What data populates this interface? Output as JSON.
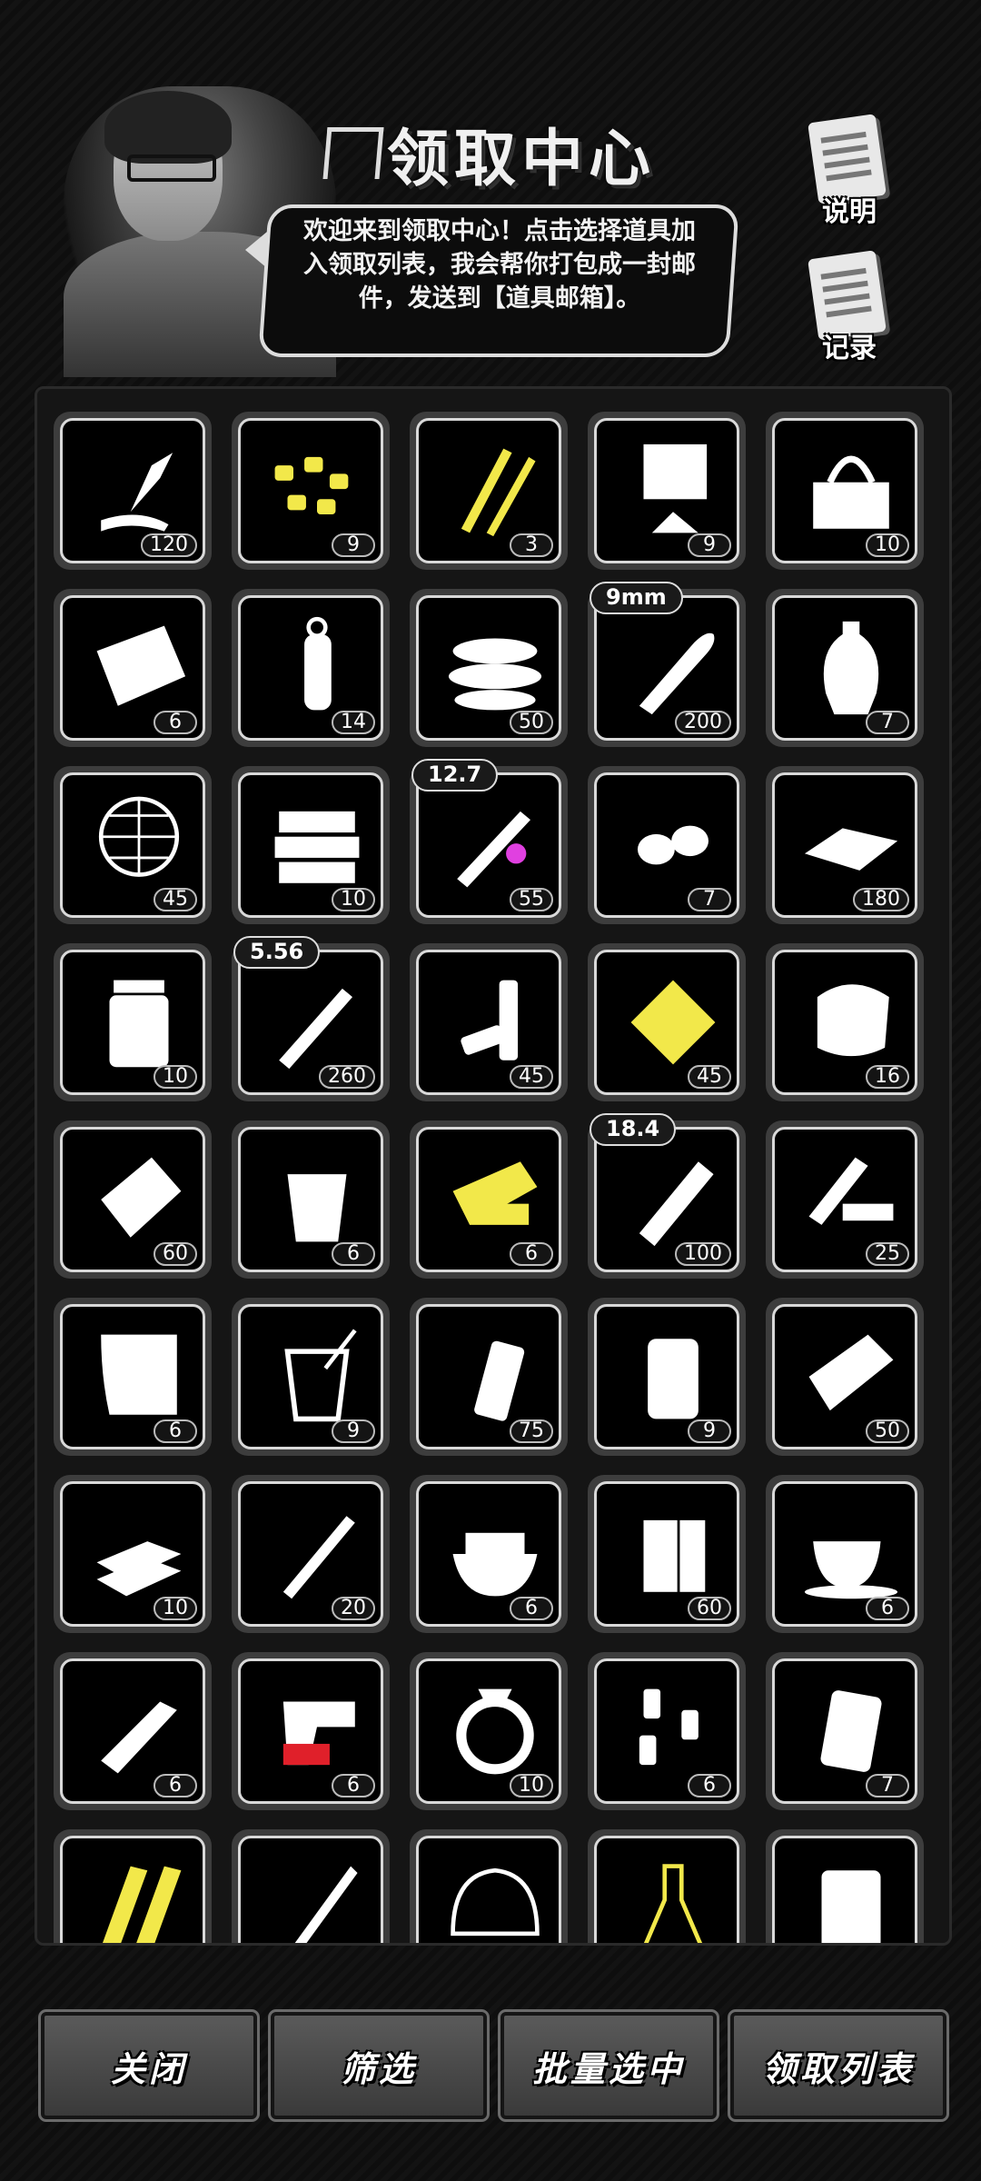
{
  "header": {
    "title": "领取中心",
    "bubble_text": "欢迎来到领取中心！点击选择道具加入领取列表，我会帮你打包成一封邮件，发送到【道具邮箱】。",
    "help_label": "说明",
    "records_label": "记录"
  },
  "items": [
    {
      "icon": "glue-tube-icon",
      "count": "120",
      "tag": "",
      "accent": "#ffffff"
    },
    {
      "icon": "corn-kernels-icon",
      "count": "9",
      "tag": "",
      "accent": "#f2e84a"
    },
    {
      "icon": "fuse-sticks-icon",
      "count": "3",
      "tag": "",
      "accent": "#f2e84a"
    },
    {
      "icon": "powder-bag-icon",
      "count": "9",
      "tag": "",
      "accent": "#ffffff"
    },
    {
      "icon": "toolbox-icon",
      "count": "10",
      "tag": "",
      "accent": "#ffffff"
    },
    {
      "icon": "cloth-rag-icon",
      "count": "6",
      "tag": "",
      "accent": "#ffffff"
    },
    {
      "icon": "grenade-icon",
      "count": "14",
      "tag": "",
      "accent": "#ffffff"
    },
    {
      "icon": "tape-roll-icon",
      "count": "50",
      "tag": "",
      "accent": "#ffffff"
    },
    {
      "icon": "bullet-9mm-icon",
      "count": "200",
      "tag": "9mm",
      "accent": "#ffffff"
    },
    {
      "icon": "vase-icon",
      "count": "7",
      "tag": "",
      "accent": "#ffffff"
    },
    {
      "icon": "net-globe-icon",
      "count": "45",
      "tag": "",
      "accent": "#ffffff"
    },
    {
      "icon": "stacked-cloth-icon",
      "count": "10",
      "tag": "",
      "accent": "#ffffff"
    },
    {
      "icon": "rifle-round-12-7-icon",
      "count": "55",
      "tag": "12.7",
      "accent": "#e040e0"
    },
    {
      "icon": "nuts-icon",
      "count": "7",
      "tag": "",
      "accent": "#ffffff"
    },
    {
      "icon": "cash-bundle-icon",
      "count": "180",
      "tag": "",
      "accent": "#ffffff"
    },
    {
      "icon": "medicine-bottle-icon",
      "count": "10",
      "tag": "",
      "accent": "#ffffff"
    },
    {
      "icon": "rifle-round-5-56-icon",
      "count": "260",
      "tag": "5.56",
      "accent": "#ffffff"
    },
    {
      "icon": "batteries-icon",
      "count": "45",
      "tag": "",
      "accent": "#ffffff"
    },
    {
      "icon": "gear-part-icon",
      "count": "45",
      "tag": "",
      "accent": "#f2e84a"
    },
    {
      "icon": "cloth-roll-icon",
      "count": "16",
      "tag": "",
      "accent": "#ffffff"
    },
    {
      "icon": "metal-plate-icon",
      "count": "60",
      "tag": "",
      "accent": "#ffffff"
    },
    {
      "icon": "juice-glass-icon",
      "count": "6",
      "tag": "",
      "accent": "#ffffff"
    },
    {
      "icon": "weapon-parts-icon",
      "count": "6",
      "tag": "",
      "accent": "#f2e84a"
    },
    {
      "icon": "shotgun-shell-18-4-icon",
      "count": "100",
      "tag": "18.4",
      "accent": "#ffffff"
    },
    {
      "icon": "wood-planks-icon",
      "count": "25",
      "tag": "",
      "accent": "#ffffff"
    },
    {
      "icon": "blueprint-scroll-icon",
      "count": "6",
      "tag": "",
      "accent": "#ffffff"
    },
    {
      "icon": "drink-straw-icon",
      "count": "9",
      "tag": "",
      "accent": "#ffffff"
    },
    {
      "icon": "smoke-grenade-icon",
      "count": "75",
      "tag": "",
      "accent": "#ffffff"
    },
    {
      "icon": "pickle-jar-icon",
      "count": "9",
      "tag": "",
      "accent": "#ffffff"
    },
    {
      "icon": "gun-parts-icon",
      "count": "50",
      "tag": "",
      "accent": "#ffffff"
    },
    {
      "icon": "gold-bars-icon",
      "count": "10",
      "tag": "",
      "accent": "#ffffff"
    },
    {
      "icon": "rocket-icon",
      "count": "20",
      "tag": "",
      "accent": "#ffffff"
    },
    {
      "icon": "sugar-bowl-icon",
      "count": "6",
      "tag": "",
      "accent": "#ffffff"
    },
    {
      "icon": "battery-pack-icon",
      "count": "60",
      "tag": "",
      "accent": "#ffffff"
    },
    {
      "icon": "coffee-cup-icon",
      "count": "6",
      "tag": "",
      "accent": "#ffffff"
    },
    {
      "icon": "ointment-tube-icon",
      "count": "6",
      "tag": "",
      "accent": "#ffffff"
    },
    {
      "icon": "flare-gun-icon",
      "count": "6",
      "tag": "",
      "accent": "#e0202a"
    },
    {
      "icon": "ring-icon",
      "count": "10",
      "tag": "",
      "accent": "#ffffff"
    },
    {
      "icon": "pill-bottles-icon",
      "count": "6",
      "tag": "",
      "accent": "#ffffff"
    },
    {
      "icon": "fuel-pouch-icon",
      "count": "7",
      "tag": "",
      "accent": "#ffffff"
    },
    {
      "icon": "firewood-icon",
      "count": "",
      "tag": "",
      "accent": "#f2e84a"
    },
    {
      "icon": "pen-icon",
      "count": "",
      "tag": "",
      "accent": "#ffffff"
    },
    {
      "icon": "hair-net-icon",
      "count": "",
      "tag": "",
      "accent": "#ffffff"
    },
    {
      "icon": "flask-icon",
      "count": "",
      "tag": "",
      "accent": "#f2e84a"
    },
    {
      "icon": "fuel-barrel-icon",
      "count": "",
      "tag": "",
      "accent": "#ffffff"
    }
  ],
  "buttons": {
    "close": "关闭",
    "filter": "筛选",
    "batch_select": "批量选中",
    "claim_list": "领取列表"
  }
}
